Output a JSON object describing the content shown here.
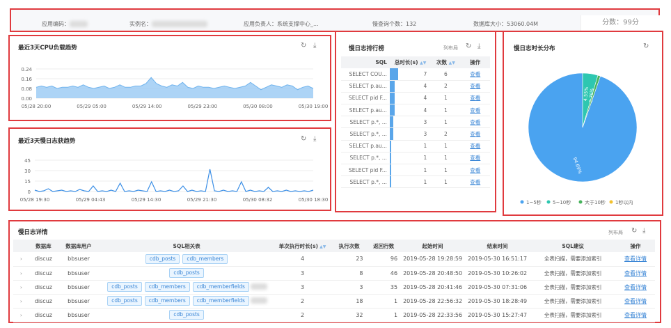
{
  "summary": {
    "app_code_label": "应用编码：",
    "instance_label": "实例名：",
    "owner": "应用负责人：系统支撑中心_...",
    "slow_query_count": "慢查询个数：132",
    "db_size": "数据库大小：53060.04M",
    "score": "分数：99分"
  },
  "cpu_chart": {
    "title": "最近3天CPU负载趋势",
    "chart_data": {
      "type": "area",
      "title": "最近3天CPU负载趋势",
      "xlabel": "",
      "ylabel": "",
      "x_ticks": [
        "05/28 20:00",
        "05/29 05:00",
        "05/29 14:00",
        "05/29 23:00",
        "05/30 08:00",
        "05/30 19:00"
      ],
      "y_ticks": [
        "0.24",
        "0.16",
        "0.08",
        "0.00"
      ],
      "ylim": [
        0,
        0.24
      ],
      "color": "#9fcdf4",
      "values": [
        0.09,
        0.1,
        0.09,
        0.1,
        0.08,
        0.09,
        0.09,
        0.1,
        0.09,
        0.11,
        0.09,
        0.08,
        0.09,
        0.1,
        0.08,
        0.09,
        0.11,
        0.09,
        0.09,
        0.1,
        0.1,
        0.12,
        0.17,
        0.12,
        0.1,
        0.09,
        0.11,
        0.1,
        0.13,
        0.09,
        0.08,
        0.1,
        0.09,
        0.09,
        0.08,
        0.09,
        0.1,
        0.09,
        0.08,
        0.09,
        0.1,
        0.13,
        0.1,
        0.07,
        0.09,
        0.11,
        0.1,
        0.09,
        0.11,
        0.1,
        0.07,
        0.09,
        0.1,
        0.08
      ]
    }
  },
  "slow_trend_chart": {
    "title": "最近3天慢日志获趋势",
    "chart_data": {
      "type": "line",
      "title": "最近3天慢日志获趋势",
      "xlabel": "",
      "ylabel": "",
      "x_ticks": [
        "05/28 19:30",
        "05/29 04:43",
        "05/29 14:30",
        "05/29 21:30",
        "05/30 08:32",
        "05/30 18:30"
      ],
      "y_ticks": [
        "45",
        "30",
        "15",
        "0"
      ],
      "ylim": [
        0,
        45
      ],
      "color": "#3a8ee6",
      "values": [
        2,
        0,
        1,
        4,
        0,
        1,
        2,
        0,
        1,
        0,
        3,
        1,
        0,
        8,
        0,
        1,
        0,
        2,
        0,
        12,
        0,
        1,
        0,
        2,
        1,
        0,
        14,
        0,
        1,
        0,
        2,
        0,
        1,
        8,
        0,
        2,
        0,
        1,
        0,
        32,
        1,
        0,
        2,
        0,
        1,
        0,
        14,
        0,
        2,
        0,
        1,
        0,
        6,
        0,
        1,
        0,
        2,
        0,
        1,
        0,
        1,
        0,
        2
      ]
    }
  },
  "ranking": {
    "title": "慢日志排行榜",
    "toolbar_text": "列布局",
    "col_sql": "SQL",
    "col_total": "总时长(s)",
    "col_count": "次数",
    "col_action": "操作",
    "view_label": "查看",
    "rows": [
      {
        "sql": "SELECT COU...",
        "total": 7,
        "count": 6
      },
      {
        "sql": "SELECT p.au...",
        "total": 4,
        "count": 2
      },
      {
        "sql": "SELECT pid F...",
        "total": 4,
        "count": 1
      },
      {
        "sql": "SELECT p.au...",
        "total": 4,
        "count": 1
      },
      {
        "sql": "SELECT p.*, ...",
        "total": 3,
        "count": 1
      },
      {
        "sql": "SELECT p.*, ...",
        "total": 3,
        "count": 2
      },
      {
        "sql": "SELECT p.au...",
        "total": 1,
        "count": 1
      },
      {
        "sql": "SELECT p.*, ...",
        "total": 1,
        "count": 1
      },
      {
        "sql": "SELECT pid F...",
        "total": 1,
        "count": 1
      },
      {
        "sql": "SELECT p.*, ...",
        "total": 1,
        "count": 1
      }
    ]
  },
  "distribution": {
    "title": "慢日志时长分布",
    "chart_data": {
      "type": "pie",
      "title": "慢日志时长分布",
      "slices": [
        {
          "label": "1~5秒",
          "value": 94.69,
          "color": "#4aa3f0",
          "text": "94.69%"
        },
        {
          "label": "5~10秒",
          "value": 4.55,
          "color": "#2ec7b0",
          "text": "4.55%"
        },
        {
          "label": "大于10秒",
          "value": 0.76,
          "color": "#47b35c",
          "text": "0.76%"
        },
        {
          "label": "1秒以内",
          "value": 0,
          "color": "#f2c12e",
          "text": ""
        }
      ],
      "legend_position": "bottom"
    }
  },
  "detail": {
    "title": "慢日志详情",
    "toolbar_text": "列布局",
    "headers": [
      "数据库",
      "数据库用户",
      "SQL相关表",
      "单次执行时长(s)",
      "执行次数",
      "返回行数",
      "起始时间",
      "结束时间",
      "SQL建议",
      "操作"
    ],
    "view_label": "查看详情",
    "rows": [
      {
        "db": "discuz",
        "user": "bbsuser",
        "tables": [
          "cdb_posts",
          "cdb_members"
        ],
        "duration": "4",
        "exec": "23",
        "rows": "96",
        "start": "2019-05-28 19:28:59",
        "end": "2019-05-30 16:51:17",
        "advice": "全表扫描，需要添加索引"
      },
      {
        "db": "discuz",
        "user": "bbsuser",
        "tables": [
          "cdb_posts"
        ],
        "duration": "3",
        "exec": "8",
        "rows": "46",
        "start": "2019-05-28 20:48:50",
        "end": "2019-05-30 10:26:02",
        "advice": "全表扫描，需要添加索引"
      },
      {
        "db": "discuz",
        "user": "bbsuser",
        "tables": [
          "cdb_posts",
          "cdb_members",
          "cdb_memberfields"
        ],
        "duration": "3",
        "exec": "3",
        "rows": "35",
        "start": "2019-05-28 20:41:46",
        "end": "2019-05-30 07:31:06",
        "advice": "全表扫描，需要添加索引"
      },
      {
        "db": "discuz",
        "user": "bbsuser",
        "tables": [
          "cdb_posts",
          "cdb_members",
          "cdb_memberfields"
        ],
        "duration": "2",
        "exec": "18",
        "rows": "1",
        "start": "2019-05-28 22:56:32",
        "end": "2019-05-30 18:28:49",
        "advice": "全表扫描，需要添加索引"
      },
      {
        "db": "discuz",
        "user": "bbsuser",
        "tables": [
          "cdb_posts"
        ],
        "duration": "2",
        "exec": "32",
        "rows": "1",
        "start": "2019-05-28 22:33:56",
        "end": "2019-05-30 15:27:47",
        "advice": "全表扫描，需要添加索引"
      }
    ]
  }
}
